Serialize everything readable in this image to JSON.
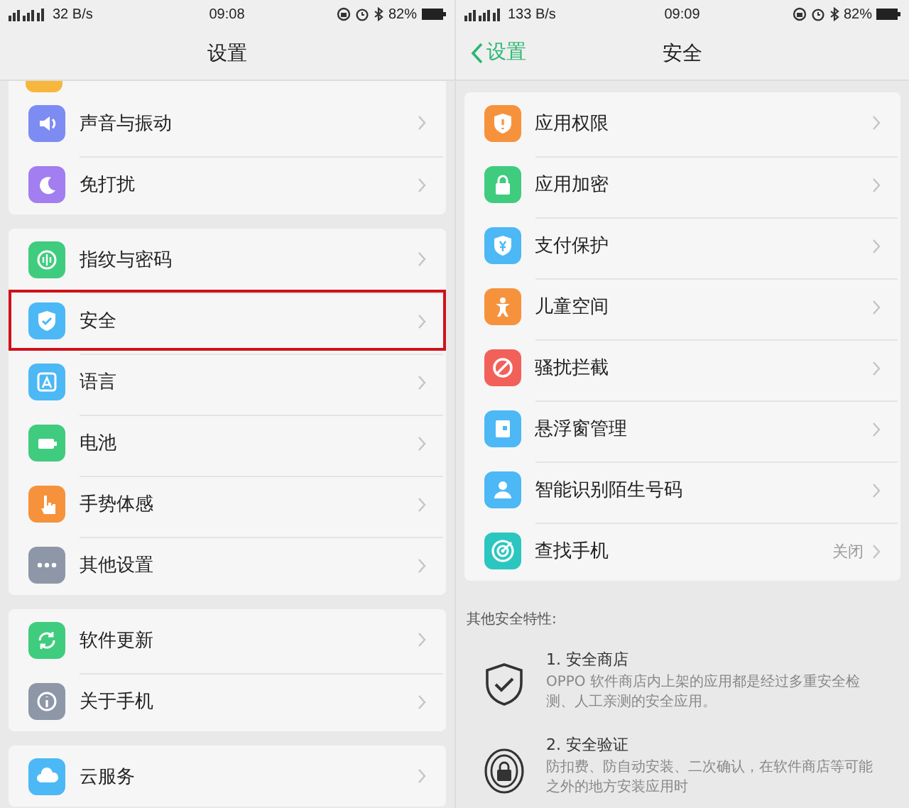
{
  "panels": [
    {
      "status_bar": {
        "speed": "32 B/s",
        "time": "09:08",
        "battery": "82%"
      },
      "title": "设置",
      "groups": [
        {
          "items": [
            {
              "kind": "cut",
              "color": "#f6b73c"
            },
            {
              "kind": "row",
              "color": "#7d8cf2",
              "label": "声音与振动",
              "selected": false
            },
            {
              "kind": "row",
              "color": "#a27ef0",
              "label": "免打扰",
              "selected": false
            }
          ]
        },
        {
          "items": [
            {
              "kind": "row",
              "color": "#3fcc7e",
              "label": "指纹与密码",
              "selected": false
            },
            {
              "kind": "row",
              "color": "#4cb8f5",
              "label": "安全",
              "selected": true
            },
            {
              "kind": "row",
              "color": "#4cb8f5",
              "label": "语言",
              "selected": false
            },
            {
              "kind": "row",
              "color": "#3fcc7e",
              "label": "电池",
              "selected": false
            },
            {
              "kind": "row",
              "color": "#f7923c",
              "label": "手势体感",
              "selected": false
            },
            {
              "kind": "row",
              "color": "#8e97a8",
              "label": "其他设置",
              "selected": false
            }
          ]
        },
        {
          "items": [
            {
              "kind": "row",
              "color": "#3fcc7e",
              "label": "软件更新",
              "selected": false
            },
            {
              "kind": "row",
              "color": "#8e97a8",
              "label": "关于手机",
              "selected": false
            }
          ]
        },
        {
          "items": [
            {
              "kind": "row",
              "color": "#4cb8f5",
              "label": "云服务",
              "selected": false
            }
          ]
        }
      ]
    },
    {
      "status_bar": {
        "speed": "133 B/s",
        "time": "09:09",
        "battery": "82%"
      },
      "back": "设置",
      "title": "安全",
      "groups": [
        {
          "items": [
            {
              "kind": "row",
              "color": "#f7923c",
              "label": "应用权限",
              "selected": false
            },
            {
              "kind": "row",
              "color": "#3fcc7e",
              "label": "应用加密",
              "selected": false
            },
            {
              "kind": "row",
              "color": "#4cb8f5",
              "label": "支付保护",
              "selected": false
            },
            {
              "kind": "row",
              "color": "#f7923c",
              "label": "儿童空间",
              "selected": false
            },
            {
              "kind": "row",
              "color": "#f2605a",
              "label": "骚扰拦截",
              "selected": false
            },
            {
              "kind": "row",
              "color": "#4cb8f5",
              "label": "悬浮窗管理",
              "selected": false
            },
            {
              "kind": "row",
              "color": "#4cb8f5",
              "label": "智能识别陌生号码",
              "selected": false
            },
            {
              "kind": "row",
              "color": "#2cc6c0",
              "label": "查找手机",
              "value": "关闭",
              "selected": false
            }
          ]
        }
      ],
      "features_title": "其他安全特性:",
      "features": [
        {
          "title": "1. 安全商店",
          "text": "OPPO 软件商店内上架的应用都是经过多重安全检测、人工亲测的安全应用。"
        },
        {
          "title": "2. 安全验证",
          "text": "防扣费、防自动安装、二次确认，在软件商店等可能之外的地方安装应用时"
        }
      ]
    }
  ]
}
